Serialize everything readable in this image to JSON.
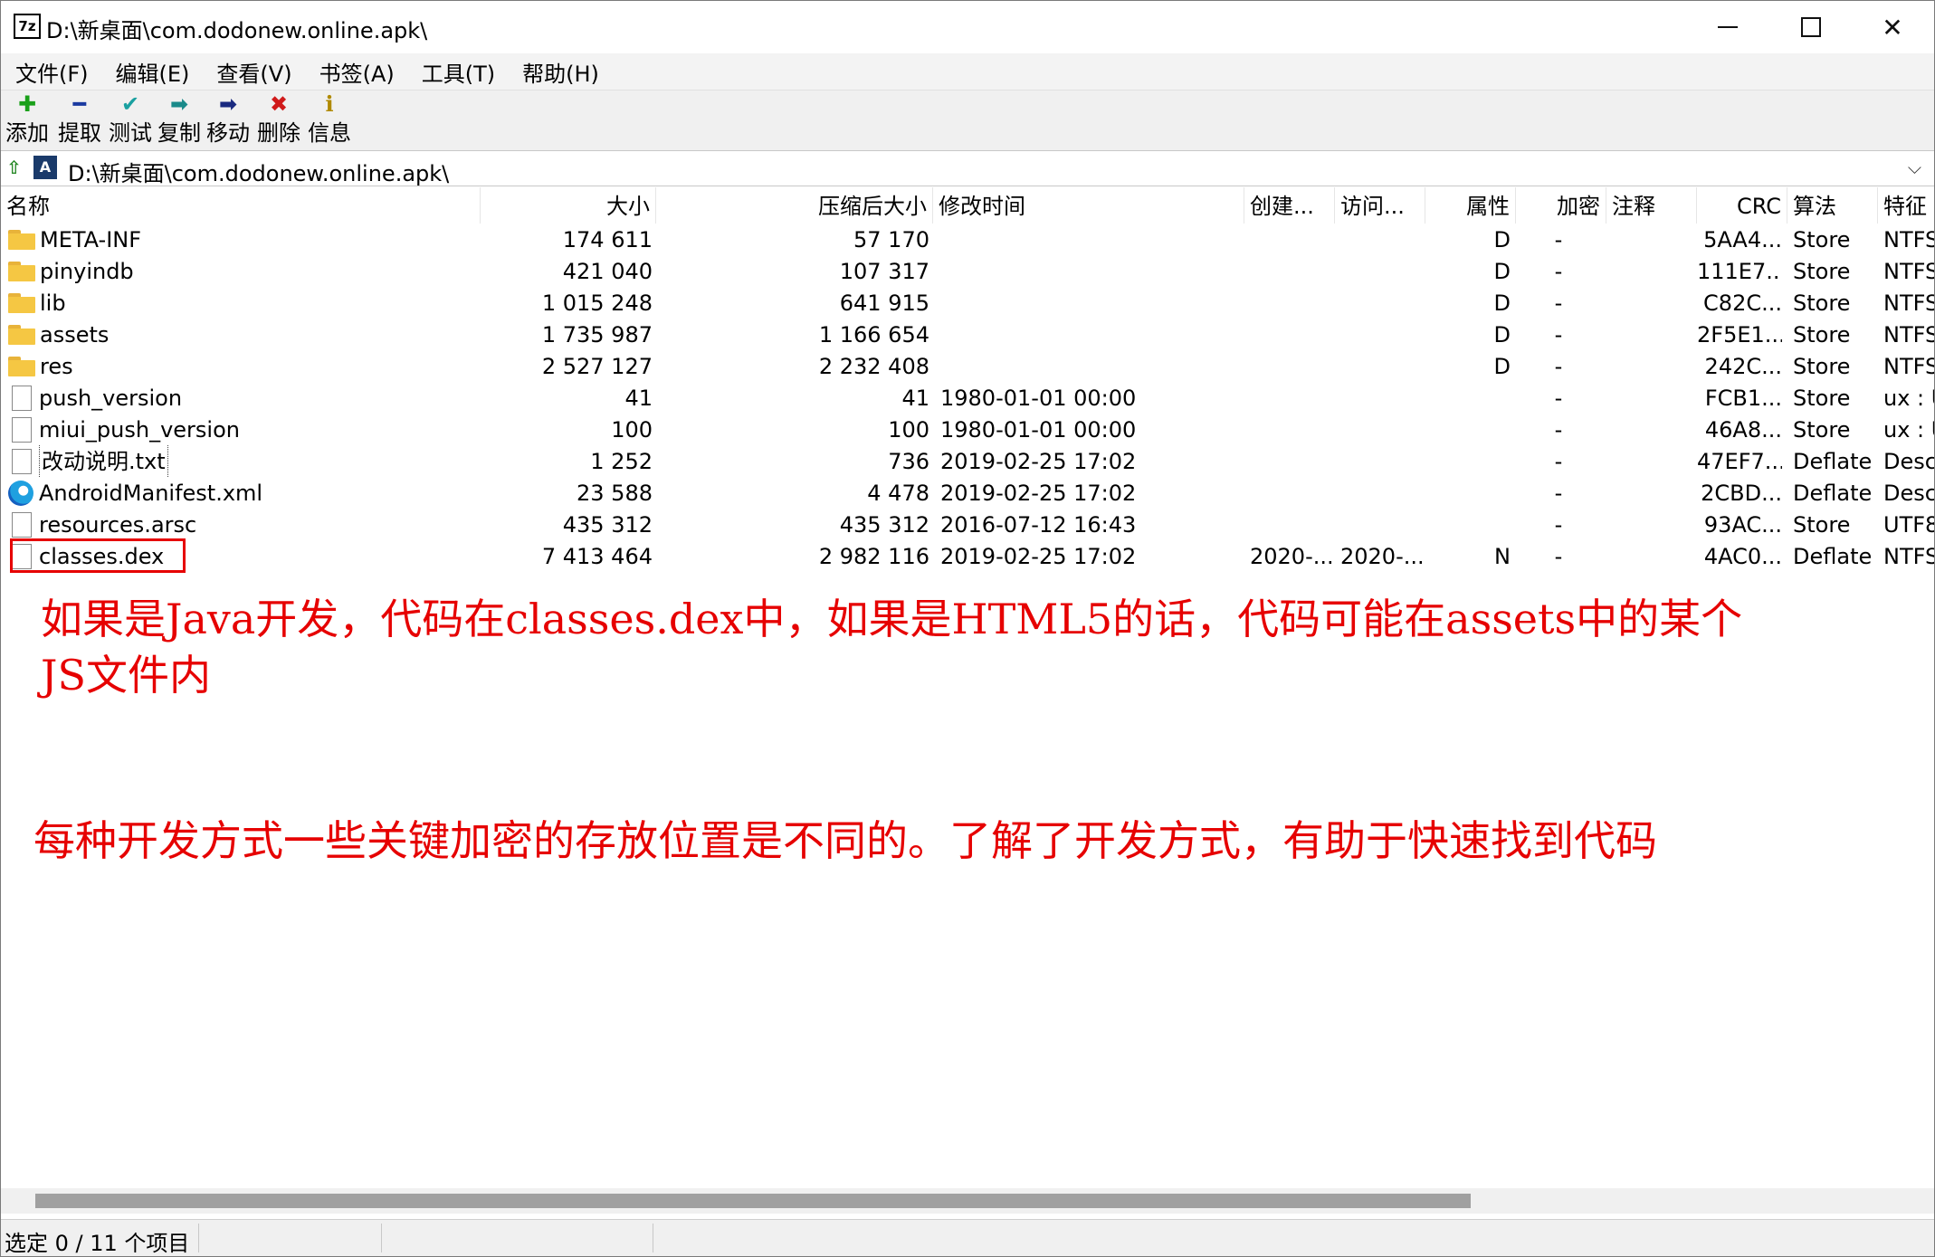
{
  "window": {
    "title": "D:\\新桌面\\com.dodonew.online.apk\\",
    "app_icon": "7z",
    "min_icon": "minimize-icon",
    "max_icon": "maximize-icon",
    "close_icon": "close-icon"
  },
  "menu": [
    "文件(F)",
    "编辑(E)",
    "查看(V)",
    "书签(A)",
    "工具(T)",
    "帮助(H)"
  ],
  "toolbar": [
    {
      "label": "添加",
      "icon": "plus-icon",
      "glyph": "✚",
      "color": "#1aa01a"
    },
    {
      "label": "提取",
      "icon": "minus-icon",
      "glyph": "━",
      "color": "#1a3aa0"
    },
    {
      "label": "测试",
      "icon": "check-icon",
      "glyph": "✔",
      "color": "#1aa0a0"
    },
    {
      "label": "复制",
      "icon": "copy-arrow-icon",
      "glyph": "➡",
      "color": "#1a8a8a"
    },
    {
      "label": "移动",
      "icon": "move-arrow-icon",
      "glyph": "➡",
      "color": "#1a2a80"
    },
    {
      "label": "删除",
      "icon": "delete-icon",
      "glyph": "✖",
      "color": "#d01a1a"
    },
    {
      "label": "信息",
      "icon": "info-icon",
      "glyph": "ℹ",
      "color": "#b08a00"
    }
  ],
  "address": {
    "path": "D:\\新桌面\\com.dodonew.online.apk\\",
    "chevron": "⌵"
  },
  "columns": {
    "name": "名称",
    "size": "大小",
    "packed": "压缩后大小",
    "modified": "修改时间",
    "created": "创建...",
    "accessed": "访问...",
    "attr": "属性",
    "encrypted": "加密",
    "comment": "注释",
    "crc": "CRC",
    "method": "算法",
    "characteristics": "特征"
  },
  "rows": [
    {
      "name": "META-INF",
      "type": "folder",
      "size": "174 611",
      "packed": "57 170",
      "modified": "",
      "created": "",
      "accessed": "",
      "attr": "D",
      "encrypted": "-",
      "comment": "",
      "crc": "5AA4...",
      "method": "Store",
      "characteristics": "NTFS"
    },
    {
      "name": "pinyindb",
      "type": "folder",
      "size": "421 040",
      "packed": "107 317",
      "modified": "",
      "created": "",
      "accessed": "",
      "attr": "D",
      "encrypted": "-",
      "comment": "",
      "crc": "111E7...",
      "method": "Store",
      "characteristics": "NTFS"
    },
    {
      "name": "lib",
      "type": "folder",
      "size": "1 015 248",
      "packed": "641 915",
      "modified": "",
      "created": "",
      "accessed": "",
      "attr": "D",
      "encrypted": "-",
      "comment": "",
      "crc": "C82C...",
      "method": "Store",
      "characteristics": "NTFS"
    },
    {
      "name": "assets",
      "type": "folder",
      "size": "1 735 987",
      "packed": "1 166 654",
      "modified": "",
      "created": "",
      "accessed": "",
      "attr": "D",
      "encrypted": "-",
      "comment": "",
      "crc": "2F5E1...",
      "method": "Store",
      "characteristics": "NTFS"
    },
    {
      "name": "res",
      "type": "folder",
      "size": "2 527 127",
      "packed": "2 232 408",
      "modified": "",
      "created": "",
      "accessed": "",
      "attr": "D",
      "encrypted": "-",
      "comment": "",
      "crc": "242C...",
      "method": "Store",
      "characteristics": "NTFS"
    },
    {
      "name": "push_version",
      "type": "file",
      "size": "41",
      "packed": "41",
      "modified": "1980-01-01 00:00",
      "created": "",
      "accessed": "",
      "attr": "",
      "encrypted": "-",
      "comment": "",
      "crc": "FCB1...",
      "method": "Store",
      "characteristics": "ux : U"
    },
    {
      "name": "miui_push_version",
      "type": "file",
      "size": "100",
      "packed": "100",
      "modified": "1980-01-01 00:00",
      "created": "",
      "accessed": "",
      "attr": "",
      "encrypted": "-",
      "comment": "",
      "crc": "46A8...",
      "method": "Store",
      "characteristics": "ux : U"
    },
    {
      "name": "改动说明.txt",
      "type": "file",
      "boxed": true,
      "size": "1 252",
      "packed": "736",
      "modified": "2019-02-25 17:02",
      "created": "",
      "accessed": "",
      "attr": "",
      "encrypted": "-",
      "comment": "",
      "crc": "47EF7...",
      "method": "Deflate",
      "characteristics": "Desc"
    },
    {
      "name": "AndroidManifest.xml",
      "type": "edge",
      "size": "23 588",
      "packed": "4 478",
      "modified": "2019-02-25 17:02",
      "created": "",
      "accessed": "",
      "attr": "",
      "encrypted": "-",
      "comment": "",
      "crc": "2CBD...",
      "method": "Deflate",
      "characteristics": "Desc"
    },
    {
      "name": "resources.arsc",
      "type": "file",
      "size": "435 312",
      "packed": "435 312",
      "modified": "2016-07-12 16:43",
      "created": "",
      "accessed": "",
      "attr": "",
      "encrypted": "-",
      "comment": "",
      "crc": "93AC...",
      "method": "Store",
      "characteristics": "UTF8"
    },
    {
      "name": "classes.dex",
      "type": "file",
      "size": "7 413 464",
      "packed": "2 982 116",
      "modified": "2019-02-25 17:02",
      "created": "2020-...",
      "accessed": "2020-...",
      "attr": "N",
      "encrypted": "-",
      "comment": "",
      "crc": "4AC0...",
      "method": "Deflate",
      "characteristics": "NTFS"
    }
  ],
  "annotation": {
    "line1": "如果是Java开发，代码在classes.dex中，如果是HTML5的话，代码可能在assets中的某个",
    "line2": "JS文件内",
    "line3": "每种开发方式一些关键加密的存放位置是不同的。了解了开发方式，有助于快速找到代码",
    "color": "#e60000"
  },
  "status": {
    "text": "选定 0 / 11 个项目"
  }
}
